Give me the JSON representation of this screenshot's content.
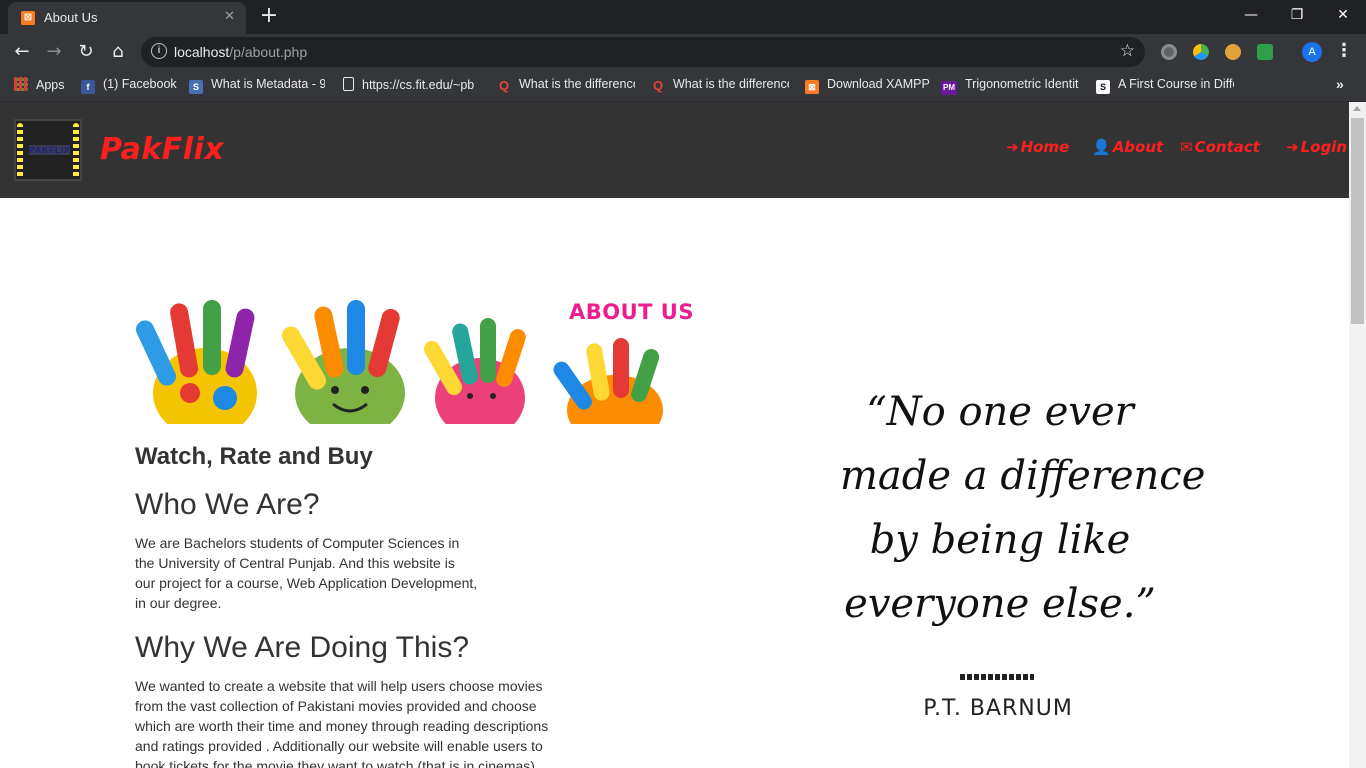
{
  "browser": {
    "tab_title": "About Us",
    "tab_favicon": "xampp-icon",
    "tab_close": "✕",
    "new_tab": "+",
    "url_host": "localhost",
    "url_path": "/p/about.php",
    "window_controls": {
      "minimize": "—",
      "restore": "❐",
      "close": "✕"
    },
    "nav": {
      "back": "←",
      "forward": "→",
      "reload": "↻",
      "home": "⌂",
      "star": "☆"
    },
    "profile_initial": "A",
    "menu": "⋮"
  },
  "bookmarks": [
    {
      "label": "Apps",
      "icon": "apps-grid-icon",
      "color": "#e8eaed"
    },
    {
      "label": "(1) Facebook",
      "icon": "facebook-icon",
      "color": "#3b5998"
    },
    {
      "label": "What is Metadata - 9",
      "icon": "bookmark-icon",
      "color": "#4a6fb5"
    },
    {
      "label": "https://cs.fit.edu/~pb",
      "icon": "page-icon",
      "color": "#e8eaed"
    },
    {
      "label": "What is the difference",
      "icon": "quora-icon",
      "color": "#b92b27"
    },
    {
      "label": "What is the difference",
      "icon": "quora-icon",
      "color": "#b92b27"
    },
    {
      "label": "Download XAMPP",
      "icon": "xampp-icon",
      "color": "#fb7a24"
    },
    {
      "label": "Trigonometric Identit",
      "icon": "pm-icon",
      "color": "#6a1b9a"
    },
    {
      "label": "A First Course in Diffe",
      "icon": "s-icon",
      "color": "#111111"
    }
  ],
  "site": {
    "logo_text": "PAKFLIX",
    "brand": "PakFlix",
    "nav": [
      {
        "label": "Home",
        "icon": "sign-in-icon"
      },
      {
        "label": "About",
        "icon": "user-icon"
      },
      {
        "label": "Contact",
        "icon": "envelope-icon"
      },
      {
        "label": "Login",
        "icon": "sign-in-icon"
      }
    ],
    "accent": "#ff1f1f",
    "header_bg": "#333333"
  },
  "banner": {
    "title": "ABOUT US"
  },
  "content": {
    "tagline": "Watch, Rate and Buy",
    "who_heading": "Who We Are?",
    "who_lines": [
      "We are Bachelors students of Computer Sciences in",
      "the University of Central Punjab. And this website is",
      "our project for a course, Web Application Development,",
      "in our degree."
    ],
    "why_heading": "Why We Are Doing This?",
    "why_lines": [
      "We wanted to create a website that will help users choose movies",
      "from the vast collection of Pakistani movies provided and choose",
      "which are worth their time and money through reading descriptions",
      "and ratings provided . Additionally our website will enable users to",
      "book tickets for the movie they want to watch (that is in cinemas)."
    ]
  },
  "quote": {
    "lines": [
      "“No one ever",
      "made a difference",
      "by being like",
      "everyone else.”"
    ],
    "author": "P.T. BARNUM"
  }
}
